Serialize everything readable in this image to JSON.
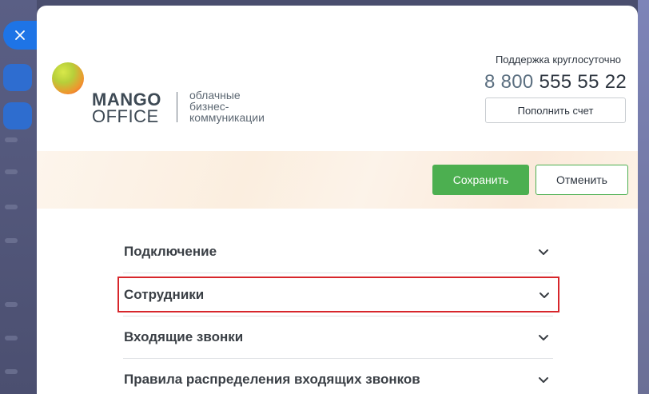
{
  "close_label": "×",
  "logo": {
    "brand_line1": "MANGO",
    "brand_line2": "OFFICE",
    "tagline": [
      "облачные",
      "бизнес-",
      "коммуникации"
    ]
  },
  "support": {
    "label": "Поддержка круглосуточно",
    "phone_prefix": "8 800",
    "phone_number": "555 55 22",
    "topup_label": "Пополнить счет"
  },
  "actions": {
    "save_label": "Сохранить",
    "cancel_label": "Отменить"
  },
  "sections": [
    {
      "label": "Подключение"
    },
    {
      "label": "Сотрудники"
    },
    {
      "label": "Входящие звонки"
    },
    {
      "label": "Правила распределения входящих звонков"
    }
  ],
  "colors": {
    "accent_green": "#4caf50",
    "highlight_red": "#d7262b",
    "close_blue": "#1e74e6"
  }
}
